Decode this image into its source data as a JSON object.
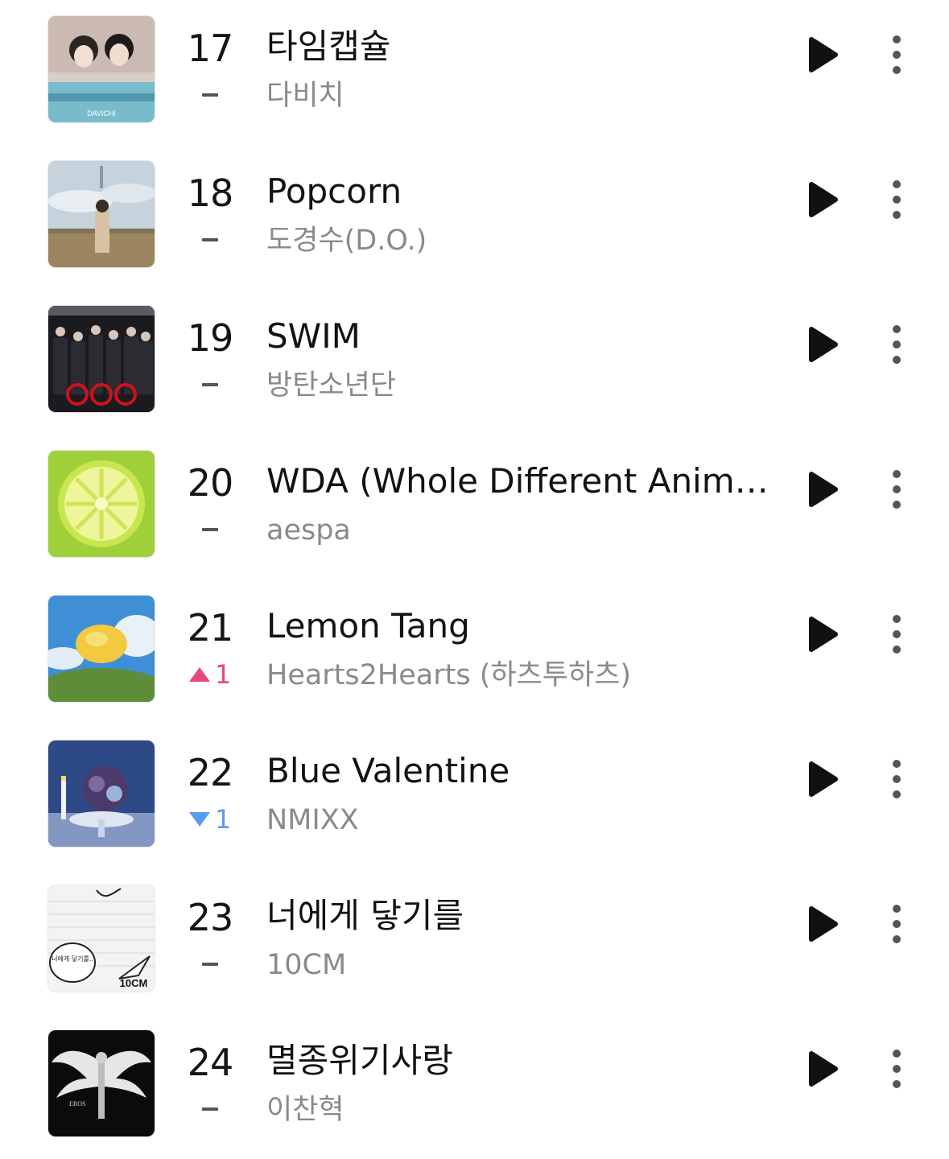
{
  "chart": {
    "tracks": [
      {
        "rank": "17",
        "title": "타임캡슐",
        "artist": "다비치",
        "change": {
          "direction": "none",
          "amount": ""
        },
        "cover_text": "DAVICHI",
        "cover_palette": [
          "#c9b8b0",
          "#7fb8c9"
        ]
      },
      {
        "rank": "18",
        "title": "Popcorn",
        "artist": "도경수(D.O.)",
        "change": {
          "direction": "none",
          "amount": ""
        },
        "cover_text": "",
        "cover_palette": [
          "#b9c7d3",
          "#8c7a5c"
        ]
      },
      {
        "rank": "19",
        "title": "SWIM",
        "artist": "방탄소년단",
        "change": {
          "direction": "none",
          "amount": ""
        },
        "cover_text": "",
        "cover_palette": [
          "#1a1a1e",
          "#b3121a"
        ]
      },
      {
        "rank": "20",
        "title": "WDA (Whole Different Animal...",
        "artist": "aespa",
        "change": {
          "direction": "none",
          "amount": ""
        },
        "cover_text": "",
        "cover_palette": [
          "#a8d63a",
          "#e8f27a"
        ]
      },
      {
        "rank": "21",
        "title": "Lemon Tang",
        "artist": "Hearts2Hearts (하츠투하츠)",
        "change": {
          "direction": "up",
          "amount": "1"
        },
        "cover_text": "",
        "cover_palette": [
          "#3f8fd6",
          "#5e8d3a"
        ]
      },
      {
        "rank": "22",
        "title": "Blue Valentine",
        "artist": "NMIXX",
        "change": {
          "direction": "down",
          "amount": "1"
        },
        "cover_text": "",
        "cover_palette": [
          "#2d4a86",
          "#9aa8c8"
        ]
      },
      {
        "rank": "23",
        "title": "너에게 닿기를",
        "artist": "10CM",
        "change": {
          "direction": "none",
          "amount": ""
        },
        "cover_text": "10CM",
        "cover_bubble_text": "너에게 닿기를..",
        "cover_palette": [
          "#f2f2f2",
          "#222222"
        ]
      },
      {
        "rank": "24",
        "title": "멸종위기사랑",
        "artist": "이찬혁",
        "change": {
          "direction": "none",
          "amount": ""
        },
        "cover_text": "EROS",
        "cover_palette": [
          "#0b0b0b",
          "#e8e8e8"
        ]
      }
    ]
  },
  "colors": {
    "rank_up": "#e8477e",
    "rank_down": "#5b9cf3",
    "artist_text": "#8a8a8a",
    "title_text": "#121212"
  },
  "icons": {
    "play": "play-triangle-icon",
    "more": "vertical-ellipsis-icon"
  }
}
